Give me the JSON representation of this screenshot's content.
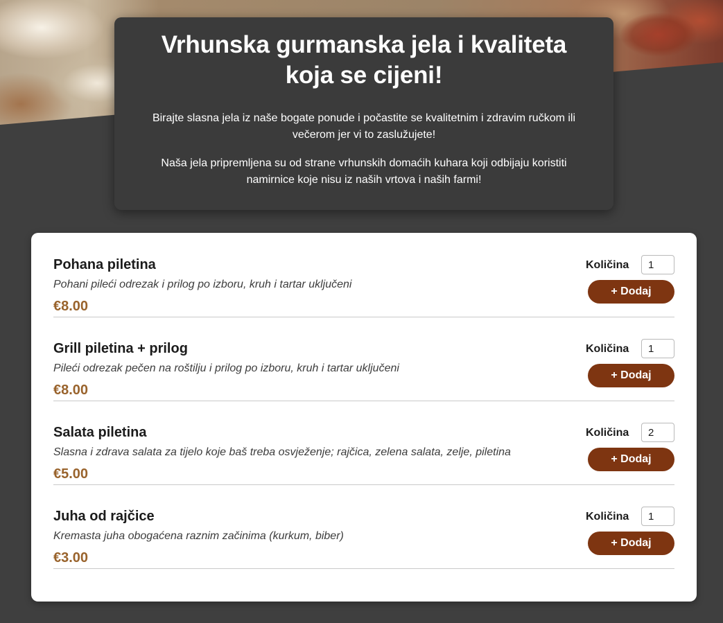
{
  "hero": {
    "title": "Vrhunska gurmanska jela i kvaliteta koja se cijeni!",
    "paragraph1": "Birajte slasna jela iz naše bogate ponude i počastite se kvalitetnim i zdravim ručkom ili večerom jer vi to zaslužujete!",
    "paragraph2": "Naša jela pripremljena su od strane vrhunskih domaćih kuhara koji odbijaju koristiti namirnice koje nisu iz naših vrtova i naših farmi!"
  },
  "menu": {
    "items": [
      {
        "name": "Pohana piletina",
        "description": "Pohani pileći odrezak i prilog po izboru, kruh i tartar uključeni",
        "price": "€8.00",
        "quantity_label": "Količina",
        "quantity": "1",
        "add_label": "+ Dodaj"
      },
      {
        "name": "Grill piletina + prilog",
        "description": "Pileći odrezak pečen na roštilju i prilog po izboru, kruh i tartar uključeni",
        "price": "€8.00",
        "quantity_label": "Količina",
        "quantity": "1",
        "add_label": "+ Dodaj"
      },
      {
        "name": "Salata piletina",
        "description": "Slasna i zdrava salata za tijelo koje baš treba osvježenje; rajčica, zelena salata, zelje, piletina",
        "price": "€5.00",
        "quantity_label": "Količina",
        "quantity": "2",
        "add_label": "+ Dodaj"
      },
      {
        "name": "Juha od rajčice",
        "description": "Kremasta juha obogaćena raznim začinima (kurkum, biber)",
        "price": "€3.00",
        "quantity_label": "Količina",
        "quantity": "1",
        "add_label": "+ Dodaj"
      }
    ]
  },
  "colors": {
    "page_background": "#3f3f3f",
    "hero_card": "#3b3b3b",
    "button": "#7e3511",
    "price": "#99632c"
  }
}
